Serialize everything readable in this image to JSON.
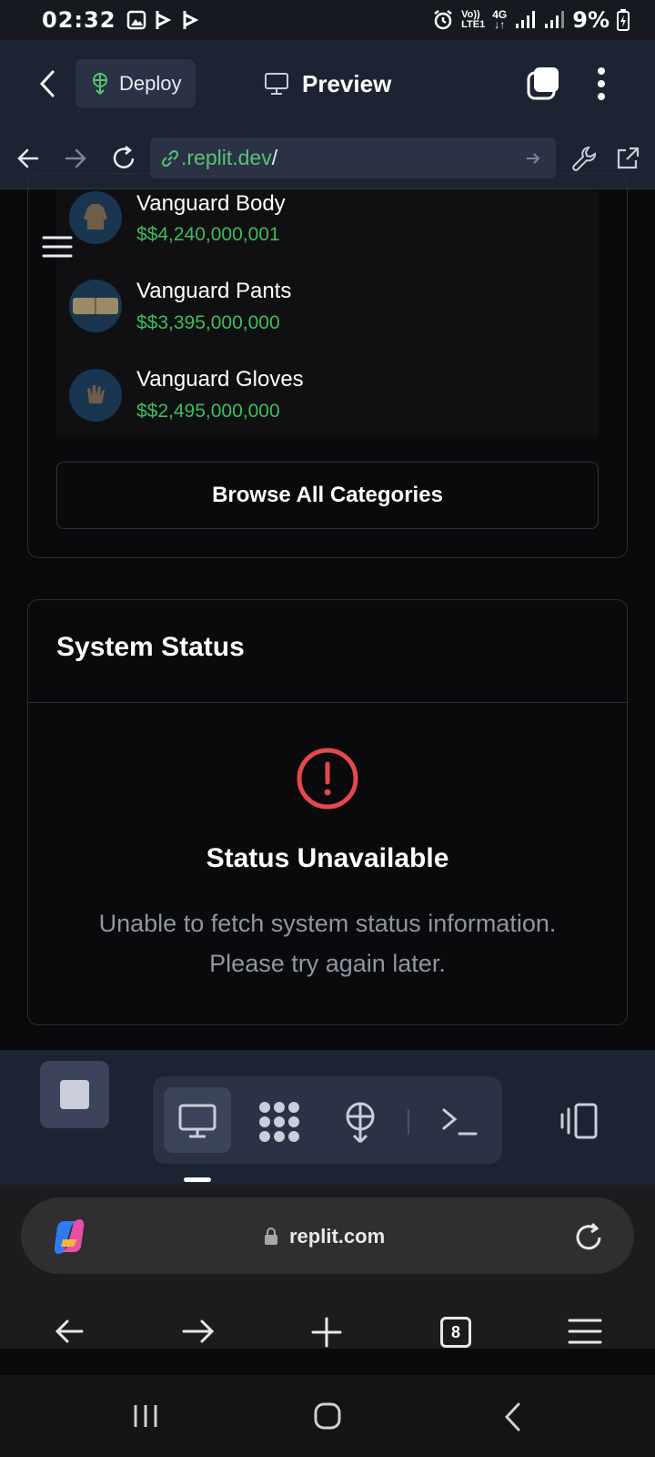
{
  "status_bar": {
    "time": "02:32",
    "network_label_top": "Vo))",
    "network_label_bottom": "LTE1",
    "network_type": "4G",
    "battery_percent": "9%",
    "icons": [
      "gallery-icon",
      "b-app-icon",
      "b-app-icon",
      "alarm-icon",
      "signal-icon",
      "battery-charging-icon"
    ]
  },
  "replit_header": {
    "deploy_label": "Deploy",
    "preview_label": "Preview"
  },
  "url_bar": {
    "link_text": ".replit.dev",
    "slash": "/"
  },
  "items": [
    {
      "name": "Vanguard Body",
      "price": "$$4,240,000,001"
    },
    {
      "name": "Vanguard Pants",
      "price": "$$3,395,000,000"
    },
    {
      "name": "Vanguard Gloves",
      "price": "$$2,495,000,000"
    }
  ],
  "browse_label": "Browse All Categories",
  "system_status": {
    "title": "System Status",
    "heading": "Status Unavailable",
    "message_line1": "Unable to fetch system status information.",
    "message_line2": "Please try again later."
  },
  "browser": {
    "address": "replit.com",
    "tab_count": "8"
  },
  "colors": {
    "accent_green": "#3dbd5b",
    "error_red": "#e5484d",
    "panel_bg": "#1c2333",
    "page_bg": "#0a0a0c"
  }
}
